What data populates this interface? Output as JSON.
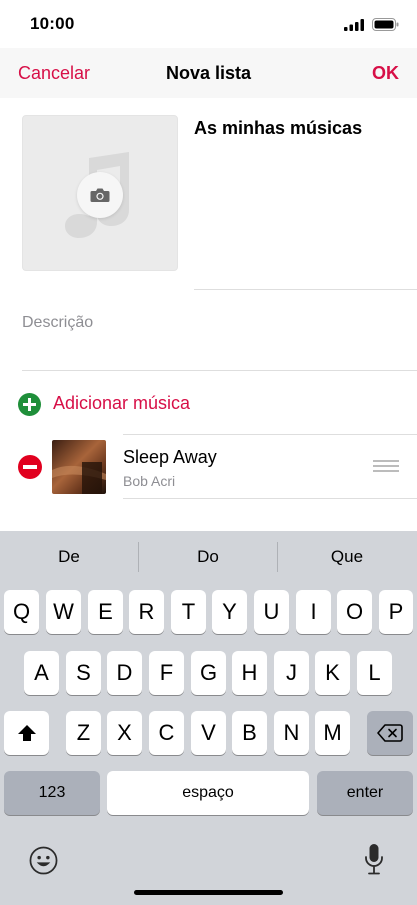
{
  "status": {
    "time": "10:00"
  },
  "nav": {
    "cancel": "Cancelar",
    "title": "Nova lista",
    "ok": "OK"
  },
  "playlist": {
    "name": "As minhas músicas",
    "description_placeholder": "Descrição",
    "add_music_label": "Adicionar música",
    "songs": [
      {
        "title": "Sleep Away",
        "artist": "Bob Acri"
      }
    ]
  },
  "keyboard": {
    "suggestions": [
      "De",
      "Do",
      "Que"
    ],
    "row1": [
      "Q",
      "W",
      "E",
      "R",
      "T",
      "Y",
      "U",
      "I",
      "O",
      "P"
    ],
    "row2": [
      "A",
      "S",
      "D",
      "F",
      "G",
      "H",
      "J",
      "K",
      "L"
    ],
    "row3": [
      "Z",
      "X",
      "C",
      "V",
      "B",
      "N",
      "M"
    ],
    "numbers_key": "123",
    "space_key": "espaço",
    "enter_key": "enter"
  },
  "colors": {
    "accent": "#d70f47",
    "add_green": "#1f8f3a",
    "remove_red": "#e1001f",
    "keyboard_bg": "#d1d4d9"
  },
  "icons": [
    "signal-icon",
    "battery-icon",
    "camera-icon",
    "music-note-icon",
    "add-icon",
    "remove-icon",
    "reorder-handle-icon",
    "shift-icon",
    "backspace-icon",
    "emoji-icon",
    "microphone-icon"
  ]
}
